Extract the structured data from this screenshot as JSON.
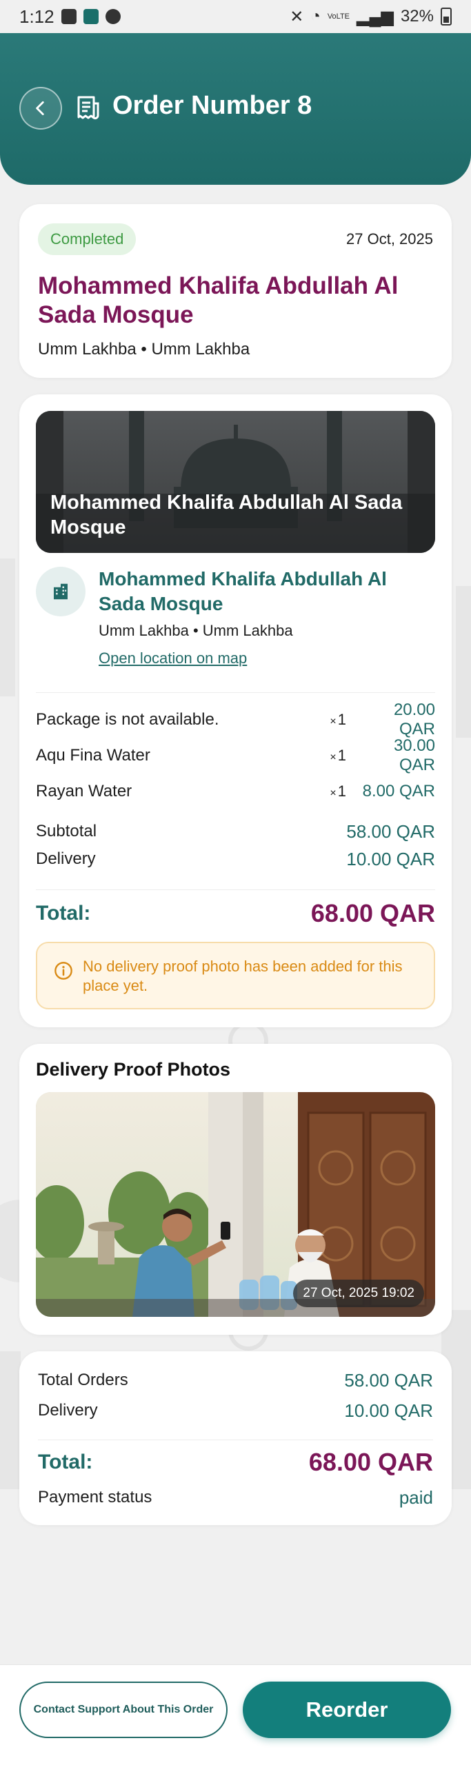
{
  "status_bar": {
    "time": "1:12",
    "network": "VoLTE",
    "battery": "32%"
  },
  "header": {
    "title": "Order Number 8",
    "back_icon": "chevron-left-icon",
    "title_icon": "receipt-icon"
  },
  "order_summary": {
    "status": "Completed",
    "date": "27 Oct, 2025",
    "mosque_name": "Mohammed Khalifa Abdullah Al Sada Mosque",
    "location": "Umm Lakhba • Umm Lakhba"
  },
  "place": {
    "hero_title": "Mohammed Khalifa Abdullah Al Sada Mosque",
    "name": "Mohammed Khalifa Abdullah Al Sada Mosque",
    "location": "Umm Lakhba • Umm Lakhba",
    "map_link": "Open location on map",
    "items": [
      {
        "name": "Package is not available.",
        "qty": "1",
        "price": "20.00 QAR"
      },
      {
        "name": "Aqu Fina Water",
        "qty": "1",
        "price": "30.00 QAR"
      },
      {
        "name": "Rayan Water",
        "qty": "1",
        "price": "8.00 QAR"
      }
    ],
    "subtotal_label": "Subtotal",
    "subtotal_value": "58.00 QAR",
    "delivery_label": "Delivery",
    "delivery_value": "10.00 QAR",
    "total_label": "Total:",
    "total_value": "68.00 QAR",
    "notice": "No delivery proof photo has been added for this place yet."
  },
  "proof": {
    "title": "Delivery Proof Photos",
    "timestamp": "27 Oct, 2025 19:02"
  },
  "totals": {
    "orders_label": "Total Orders",
    "orders_value": "58.00 QAR",
    "delivery_label": "Delivery",
    "delivery_value": "10.00 QAR",
    "total_label": "Total:",
    "total_value": "68.00 QAR",
    "payment_label": "Payment status",
    "payment_value": "paid"
  },
  "actions": {
    "support": "Contact Support About This Order",
    "reorder": "Reorder"
  },
  "colors": {
    "primary": "#137f7c",
    "header": "#216a67",
    "accent": "#7b1657",
    "success": "#3d9a42",
    "warning": "#d98a14"
  }
}
